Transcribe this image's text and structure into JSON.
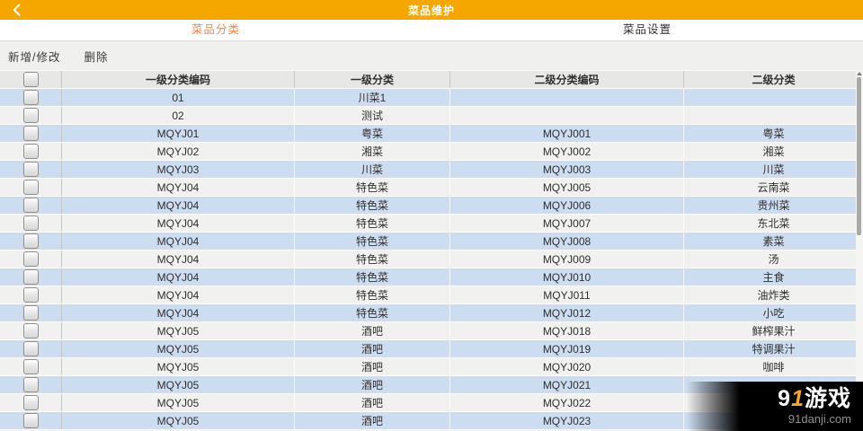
{
  "topbar": {
    "title": "菜品维护"
  },
  "tabs": [
    {
      "label": "菜品分类",
      "active": true
    },
    {
      "label": "菜品设置",
      "active": false
    }
  ],
  "toolbar": {
    "add_modify_label": "新增/修改",
    "delete_label": "删除"
  },
  "table": {
    "columns": [
      "一级分类编码",
      "一级分类",
      "二级分类编码",
      "二级分类"
    ],
    "rows": [
      [
        "01",
        "川菜1",
        "",
        ""
      ],
      [
        "02",
        "测试",
        "",
        ""
      ],
      [
        "MQYJ01",
        "粤菜",
        "MQYJ001",
        "粤菜"
      ],
      [
        "MQYJ02",
        "湘菜",
        "MQYJ002",
        "湘菜"
      ],
      [
        "MQYJ03",
        "川菜",
        "MQYJ003",
        "川菜"
      ],
      [
        "MQYJ04",
        "特色菜",
        "MQYJ005",
        "云南菜"
      ],
      [
        "MQYJ04",
        "特色菜",
        "MQYJ006",
        "贵州菜"
      ],
      [
        "MQYJ04",
        "特色菜",
        "MQYJ007",
        "东北菜"
      ],
      [
        "MQYJ04",
        "特色菜",
        "MQYJ008",
        "素菜"
      ],
      [
        "MQYJ04",
        "特色菜",
        "MQYJ009",
        "汤"
      ],
      [
        "MQYJ04",
        "特色菜",
        "MQYJ010",
        "主食"
      ],
      [
        "MQYJ04",
        "特色菜",
        "MQYJ011",
        "油炸类"
      ],
      [
        "MQYJ04",
        "特色菜",
        "MQYJ012",
        "小吃"
      ],
      [
        "MQYJ05",
        "酒吧",
        "MQYJ018",
        "鲜榨果汁"
      ],
      [
        "MQYJ05",
        "酒吧",
        "MQYJ019",
        "特调果汁"
      ],
      [
        "MQYJ05",
        "酒吧",
        "MQYJ020",
        "咖啡"
      ],
      [
        "MQYJ05",
        "酒吧",
        "MQYJ021",
        ""
      ],
      [
        "MQYJ05",
        "酒吧",
        "MQYJ022",
        ""
      ],
      [
        "MQYJ05",
        "酒吧",
        "MQYJ023",
        ""
      ]
    ]
  },
  "watermark": {
    "logo_nine": "9",
    "logo_one": "1",
    "logo_text": "游戏",
    "site": "91danji.com"
  },
  "colors": {
    "topbar_orange": "#F5A700",
    "tab_active_orange": "#F8854B",
    "row_blue": "#CDDDF1",
    "row_light": "#F1F1EF",
    "header_gray": "#E7E7E5",
    "watermark_accent": "#F5A623"
  }
}
